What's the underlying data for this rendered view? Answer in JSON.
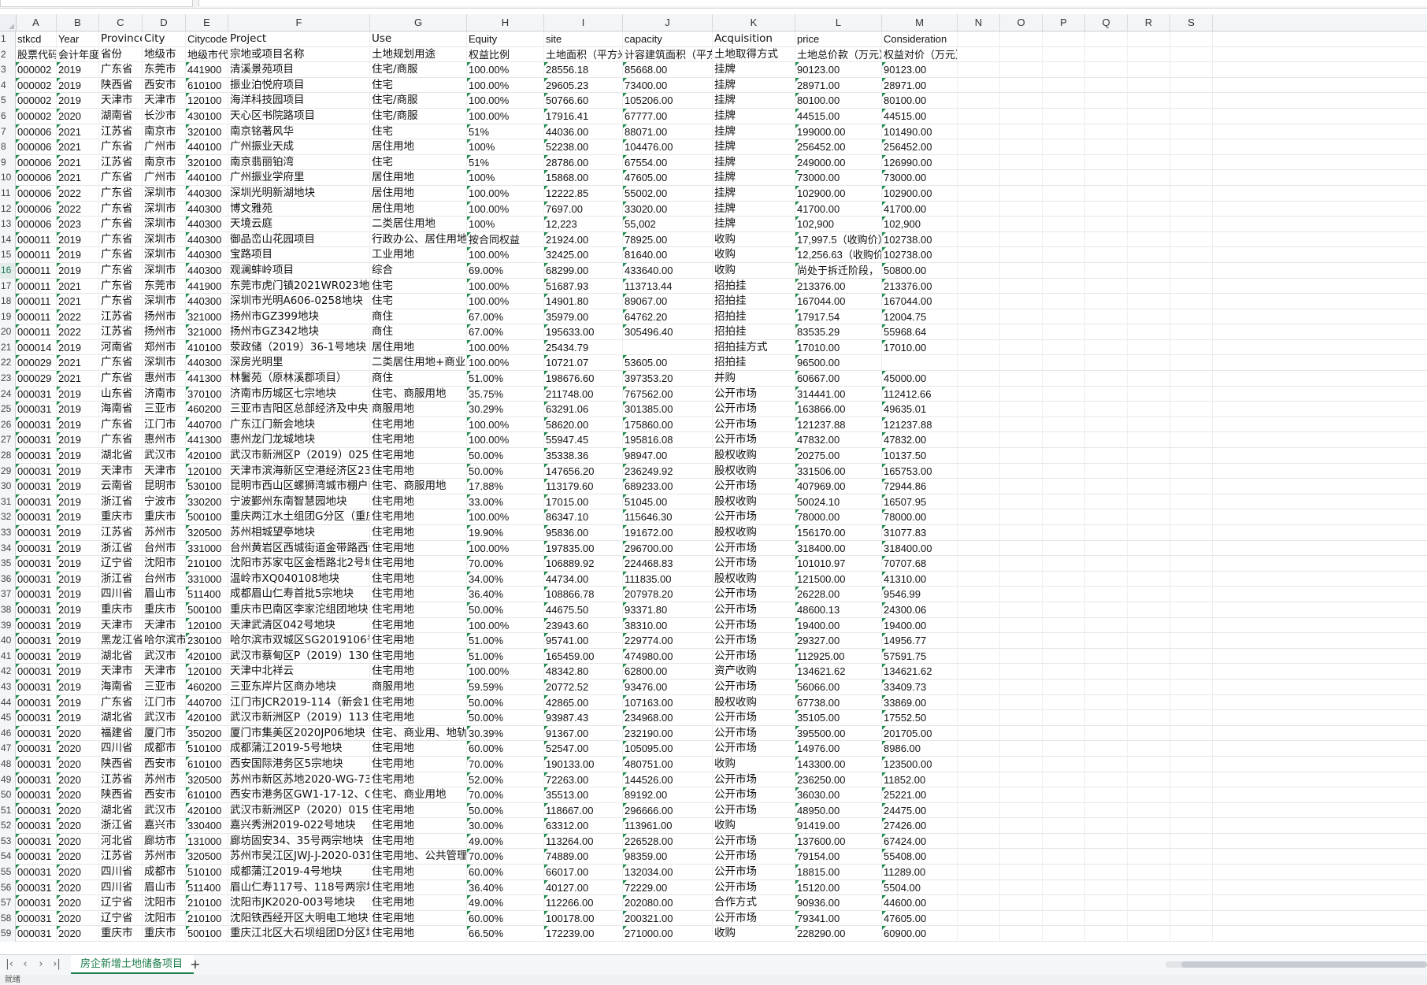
{
  "columns": [
    "A",
    "B",
    "C",
    "D",
    "E",
    "F",
    "G",
    "H",
    "I",
    "J",
    "K",
    "L",
    "M",
    "N",
    "O",
    "P",
    "Q",
    "R",
    "S"
  ],
  "rows": [
    [
      "stkcd",
      "Year",
      "Province",
      "City",
      "Citycode",
      "Project",
      "Use",
      "Equity",
      "site",
      "capacity",
      "Acquisition",
      "price",
      "Consideration"
    ],
    [
      "股票代码",
      "会计年度",
      "省份",
      "地级市",
      "地级市代码",
      "宗地或项目名称",
      "土地规划用途",
      "权益比例",
      "土地面积（平方米）",
      "计容建筑面积（平方米）",
      "土地取得方式",
      "土地总价款（万元）",
      "权益对价（万元）"
    ],
    [
      "000002",
      "2019",
      "广东省",
      "东莞市",
      "441900",
      "清溪景苑项目",
      "住宅/商服",
      "100.00%",
      "28556.18",
      "85668.00",
      "挂牌",
      "90123.00",
      "90123.00"
    ],
    [
      "000002",
      "2019",
      "陕西省",
      "西安市",
      "610100",
      "振业泊悦府项目",
      "住宅",
      "100.00%",
      "29605.23",
      "73400.00",
      "挂牌",
      "28971.00",
      "28971.00"
    ],
    [
      "000002",
      "2019",
      "天津市",
      "天津市",
      "120100",
      "海洋科技园项目",
      "住宅/商服",
      "100.00%",
      "50766.60",
      "105206.00",
      "挂牌",
      "80100.00",
      "80100.00"
    ],
    [
      "000002",
      "2020",
      "湖南省",
      "长沙市",
      "430100",
      "天心区书院路项目",
      "住宅/商服",
      "100.00%",
      "17916.41",
      "67777.00",
      "挂牌",
      "44515.00",
      "44515.00"
    ],
    [
      "000006",
      "2021",
      "江苏省",
      "南京市",
      "320100",
      "南京铭著风华",
      "住宅",
      "51%",
      "44036.00",
      "88071.00",
      "挂牌",
      "199000.00",
      "101490.00"
    ],
    [
      "000006",
      "2021",
      "广东省",
      "广州市",
      "440100",
      "广州振业天成",
      "居住用地",
      "100%",
      "52238.00",
      "104476.00",
      "挂牌",
      "256452.00",
      "256452.00"
    ],
    [
      "000006",
      "2021",
      "江苏省",
      "南京市",
      "320100",
      "南京翡丽铂湾",
      "住宅",
      "51%",
      "28786.00",
      "67554.00",
      "挂牌",
      "249000.00",
      "126990.00"
    ],
    [
      "000006",
      "2021",
      "广东省",
      "广州市",
      "440100",
      "广州振业学府里",
      "居住用地",
      "100%",
      "15868.00",
      "47605.00",
      "挂牌",
      "73000.00",
      "73000.00"
    ],
    [
      "000006",
      "2022",
      "广东省",
      "深圳市",
      "440300",
      "深圳光明新湖地块",
      "居住用地",
      "100.00%",
      "12222.85",
      "55002.00",
      "挂牌",
      "102900.00",
      "102900.00"
    ],
    [
      "000006",
      "2022",
      "广东省",
      "深圳市",
      "440300",
      "博文雅苑",
      "居住用地",
      "100.00%",
      "7697.00",
      "33020.00",
      "挂牌",
      "41700.00",
      "41700.00"
    ],
    [
      "000006",
      "2023",
      "广东省",
      "深圳市",
      "440300",
      "天境云庭",
      "二类居住用地",
      "100%",
      "12,223",
      "55,002",
      "挂牌",
      "102,900",
      "102,900"
    ],
    [
      "000011",
      "2019",
      "广东省",
      "深圳市",
      "440300",
      "御品峦山花园项目",
      "行政办公、居住用地",
      "按合同权益",
      "21924.00",
      "78925.00",
      "收购",
      "17,997.5（收购价）",
      "102738.00"
    ],
    [
      "000011",
      "2019",
      "广东省",
      "深圳市",
      "440300",
      "宝路项目",
      "工业用地",
      "100.00%",
      "32425.00",
      "81640.00",
      "收购",
      "12,256.63（收购价）",
      "102738.00"
    ],
    [
      "000011",
      "2019",
      "广东省",
      "深圳市",
      "440300",
      "观澜蚌岭项目",
      "综合",
      "69.00%",
      "68299.00",
      "433640.00",
      "收购",
      "尚处于拆迁阶段，",
      "50800.00"
    ],
    [
      "000011",
      "2021",
      "广东省",
      "东莞市",
      "441900",
      "东莞市虎门镇2021WR023地块",
      "住宅",
      "100.00%",
      "51687.93",
      "113713.44",
      "招拍挂",
      "213376.00",
      "213376.00"
    ],
    [
      "000011",
      "2021",
      "广东省",
      "深圳市",
      "440300",
      "深圳市光明A606-0258地块",
      "住宅",
      "100.00%",
      "14901.80",
      "89067.00",
      "招拍挂",
      "167044.00",
      "167044.00"
    ],
    [
      "000011",
      "2022",
      "江苏省",
      "扬州市",
      "321000",
      "扬州市GZ399地块",
      "商住",
      "67.00%",
      "35979.00",
      "64762.20",
      "招拍挂",
      "17917.54",
      "12004.75"
    ],
    [
      "000011",
      "2022",
      "江苏省",
      "扬州市",
      "321000",
      "扬州市GZ342地块",
      "商住",
      "67.00%",
      "195633.00",
      "305496.40",
      "招拍挂",
      "83535.29",
      "55968.64"
    ],
    [
      "000014",
      "2019",
      "河南省",
      "郑州市",
      "410100",
      "荥政储（2019）36-1号地块",
      "居住用地",
      "100.00%",
      "25434.79",
      "",
      "招拍挂方式",
      "17010.00",
      "17010.00"
    ],
    [
      "000029",
      "2021",
      "广东省",
      "深圳市",
      "440300",
      "深房光明里",
      "二类居住用地+商业用地",
      "100.00%",
      "10721.07",
      "53605.00",
      "招拍挂",
      "96500.00",
      ""
    ],
    [
      "000029",
      "2021",
      "广东省",
      "惠州市",
      "441300",
      "林鬐苑（原林溪郡项目）",
      "商住",
      "51.00%",
      "198676.60",
      "397353.20",
      "并购",
      "60667.00",
      "45000.00"
    ],
    [
      "000031",
      "2019",
      "山东省",
      "济南市",
      "370100",
      "济南市历城区七宗地块",
      "住宅、商服用地",
      "35.75%",
      "211748.00",
      "767562.00",
      "公开市场",
      "314441.00",
      "112412.66"
    ],
    [
      "000031",
      "2019",
      "海南省",
      "三亚市",
      "460200",
      "三亚市吉阳区总部经济及中央商务区",
      "商服用地",
      "30.29%",
      "63291.06",
      "301385.00",
      "公开市场",
      "163866.00",
      "49635.01"
    ],
    [
      "000031",
      "2019",
      "广东省",
      "江门市",
      "440700",
      "广东江门新会地块",
      "住宅用地",
      "100.00%",
      "58620.00",
      "175860.00",
      "公开市场",
      "121237.88",
      "121237.88"
    ],
    [
      "000031",
      "2019",
      "广东省",
      "惠州市",
      "441300",
      "惠州龙门龙城地块",
      "住宅用地",
      "100.00%",
      "55947.45",
      "195816.08",
      "公开市场",
      "47832.00",
      "47832.00"
    ],
    [
      "000031",
      "2019",
      "湖北省",
      "武汉市",
      "420100",
      "武汉市新洲区P（2019）025号地块",
      "住宅用地",
      "50.00%",
      "35338.36",
      "98947.00",
      "股权收购",
      "20275.00",
      "10137.50"
    ],
    [
      "000031",
      "2019",
      "天津市",
      "天津市",
      "120100",
      "天津市滨海新区空港经济区23号地块",
      "住宅用地",
      "50.00%",
      "147656.20",
      "236249.92",
      "股权收购",
      "331506.00",
      "165753.00"
    ],
    [
      "000031",
      "2019",
      "云南省",
      "昆明市",
      "530100",
      "昆明市西山区螺狮湾城市棚户区",
      "住宅、商服用地",
      "17.88%",
      "113179.60",
      "689233.00",
      "公开市场",
      "407969.00",
      "72944.86"
    ],
    [
      "000031",
      "2019",
      "浙江省",
      "宁波市",
      "330200",
      "宁波鄞州东南智慧园地块",
      "住宅用地",
      "33.00%",
      "17015.00",
      "51045.00",
      "股权收购",
      "50024.10",
      "16507.95"
    ],
    [
      "000031",
      "2019",
      "重庆市",
      "重庆市",
      "500100",
      "重庆两江水土组团G分区（重庆）",
      "住宅用地",
      "100.00%",
      "86347.10",
      "115646.30",
      "公开市场",
      "78000.00",
      "78000.00"
    ],
    [
      "000031",
      "2019",
      "江苏省",
      "苏州市",
      "320500",
      "苏州相城望亭地块",
      "住宅用地",
      "19.90%",
      "95836.00",
      "191672.00",
      "股权收购",
      "156170.00",
      "31077.83"
    ],
    [
      "000031",
      "2019",
      "浙江省",
      "台州市",
      "331000",
      "台州黄岩区西城街道金带路西侧",
      "住宅用地",
      "100.00%",
      "197835.00",
      "296700.00",
      "公开市场",
      "318400.00",
      "318400.00"
    ],
    [
      "000031",
      "2019",
      "辽宁省",
      "沈阳市",
      "210100",
      "沈阳市苏家屯区金梧路北2号地块",
      "住宅用地",
      "70.00%",
      "106889.92",
      "224468.83",
      "公开市场",
      "101010.97",
      "70707.68"
    ],
    [
      "000031",
      "2019",
      "浙江省",
      "台州市",
      "331000",
      "温岭市XQ040108地块",
      "住宅用地",
      "34.00%",
      "44734.00",
      "111835.00",
      "股权收购",
      "121500.00",
      "41310.00"
    ],
    [
      "000031",
      "2019",
      "四川省",
      "眉山市",
      "511400",
      "成都眉山仁寿首批5宗地块",
      "住宅用地",
      "36.40%",
      "108866.78",
      "207978.20",
      "公开市场",
      "26228.00",
      "9546.99"
    ],
    [
      "000031",
      "2019",
      "重庆市",
      "重庆市",
      "500100",
      "重庆市巴南区李家沱组团地块（",
      "住宅用地",
      "50.00%",
      "44675.50",
      "93371.80",
      "公开市场",
      "48600.13",
      "24300.06"
    ],
    [
      "000031",
      "2019",
      "天津市",
      "天津市",
      "120100",
      "天津武清区042号地块",
      "住宅用地",
      "100.00%",
      "23943.60",
      "38310.00",
      "公开市场",
      "19400.00",
      "19400.00"
    ],
    [
      "000031",
      "2019",
      "黑龙江省",
      "哈尔滨市",
      "230100",
      "哈尔滨市双城区SG2019106号地块",
      "住宅用地",
      "51.00%",
      "95741.00",
      "229774.00",
      "公开市场",
      "29327.00",
      "14956.77"
    ],
    [
      "000031",
      "2019",
      "湖北省",
      "武汉市",
      "420100",
      "武汉市蔡甸区P（2019）130号宗地",
      "住宅用地",
      "51.00%",
      "165459.00",
      "474980.00",
      "公开市场",
      "112925.00",
      "57591.75"
    ],
    [
      "000031",
      "2019",
      "天津市",
      "天津市",
      "120100",
      "天津中北祥云",
      "住宅用地",
      "100.00%",
      "48342.80",
      "62800.00",
      "资产收购",
      "134621.62",
      "134621.62"
    ],
    [
      "000031",
      "2019",
      "海南省",
      "三亚市",
      "460200",
      "三亚东岸片区商办地块",
      "商服用地",
      "59.59%",
      "20772.52",
      "93476.00",
      "公开市场",
      "56066.00",
      "33409.73"
    ],
    [
      "000031",
      "2019",
      "广东省",
      "江门市",
      "440700",
      "江门市JCR2019-114（新会19）号",
      "住宅用地",
      "50.00%",
      "42865.00",
      "107163.00",
      "股权收购",
      "67738.00",
      "33869.00"
    ],
    [
      "000031",
      "2019",
      "湖北省",
      "武汉市",
      "420100",
      "武汉市新洲区P（2019）113号地块",
      "住宅用地",
      "50.00%",
      "93987.43",
      "234968.00",
      "公开市场",
      "35105.00",
      "17552.50"
    ],
    [
      "000031",
      "2020",
      "福建省",
      "厦门市",
      "350200",
      "厦门市集美区2020JP06地块",
      "住宅、商业用、地轨道",
      "30.39%",
      "91367.00",
      "232190.00",
      "公开市场",
      "395500.00",
      "201705.00"
    ],
    [
      "000031",
      "2020",
      "四川省",
      "成都市",
      "510100",
      "成都蒲江2019-5号地块",
      "住宅用地",
      "60.00%",
      "52547.00",
      "105095.00",
      "公开市场",
      "14976.00",
      "8986.00"
    ],
    [
      "000031",
      "2020",
      "陕西省",
      "西安市",
      "610100",
      "西安国际港务区5宗地块",
      "住宅用地",
      "70.00%",
      "190133.00",
      "480751.00",
      "收购",
      "143300.00",
      "123500.00"
    ],
    [
      "000031",
      "2020",
      "江苏省",
      "苏州市",
      "320500",
      "苏州市新区苏地2020-WG-73号地块",
      "住宅用地",
      "52.00%",
      "72263.00",
      "144526.00",
      "公开市场",
      "236250.00",
      "11852.00"
    ],
    [
      "000031",
      "2020",
      "陕西省",
      "西安市",
      "610100",
      "西安市港务区GW1-17-12、GW1-17-13",
      "住宅、商业用地",
      "70.00%",
      "35513.00",
      "89192.00",
      "公开市场",
      "36030.00",
      "25221.00"
    ],
    [
      "000031",
      "2020",
      "湖北省",
      "武汉市",
      "420100",
      "武汉市新洲区P（2020）015号地块",
      "住宅用地",
      "50.00%",
      "118667.00",
      "296666.00",
      "公开市场",
      "48950.00",
      "24475.00"
    ],
    [
      "000031",
      "2020",
      "浙江省",
      "嘉兴市",
      "330400",
      "嘉兴秀洲2019-022号地块",
      "住宅用地",
      "30.00%",
      "63312.00",
      "113961.00",
      "收购",
      "91419.00",
      "27426.00"
    ],
    [
      "000031",
      "2020",
      "河北省",
      "廊坊市",
      "131000",
      "廊坊固安34、35号两宗地块",
      "住宅用地",
      "49.00%",
      "113264.00",
      "226528.00",
      "公开市场",
      "137600.00",
      "67424.00"
    ],
    [
      "000031",
      "2020",
      "江苏省",
      "苏州市",
      "320500",
      "苏州市吴江区JWJ-J-2020-031、WJ-J",
      "住宅用地、公共管理与",
      "70.00%",
      "74889.00",
      "98359.00",
      "公开市场",
      "79154.00",
      "55408.00"
    ],
    [
      "000031",
      "2020",
      "四川省",
      "成都市",
      "510100",
      "成都蒲江2019-4号地块",
      "住宅用地",
      "60.00%",
      "66017.00",
      "132034.00",
      "公开市场",
      "18815.00",
      "11289.00"
    ],
    [
      "000031",
      "2020",
      "四川省",
      "眉山市",
      "511400",
      "眉山仁寿117号、118号两宗地块",
      "住宅用地",
      "36.40%",
      "40127.00",
      "72229.00",
      "公开市场",
      "15120.00",
      "5504.00"
    ],
    [
      "000031",
      "2020",
      "辽宁省",
      "沈阳市",
      "210100",
      "沈阳市JK2020-003号地块",
      "住宅用地",
      "49.00%",
      "112266.00",
      "202080.00",
      "合作方式",
      "90936.00",
      "44600.00"
    ],
    [
      "000031",
      "2020",
      "辽宁省",
      "沈阳市",
      "210100",
      "沈阳铁西经开区大明电工地块",
      "住宅用地",
      "60.00%",
      "100178.00",
      "200321.00",
      "公开市场",
      "79341.00",
      "47605.00"
    ],
    [
      "000031",
      "2020",
      "重庆市",
      "重庆市",
      "500100",
      "重庆江北区大石坝组团D分区地块",
      "住宅用地",
      "66.50%",
      "172239.00",
      "271000.00",
      "收购",
      "228290.00",
      "60900.00"
    ]
  ],
  "sheet_tab": "房企新增土地储备项目",
  "status_text": "就绪"
}
